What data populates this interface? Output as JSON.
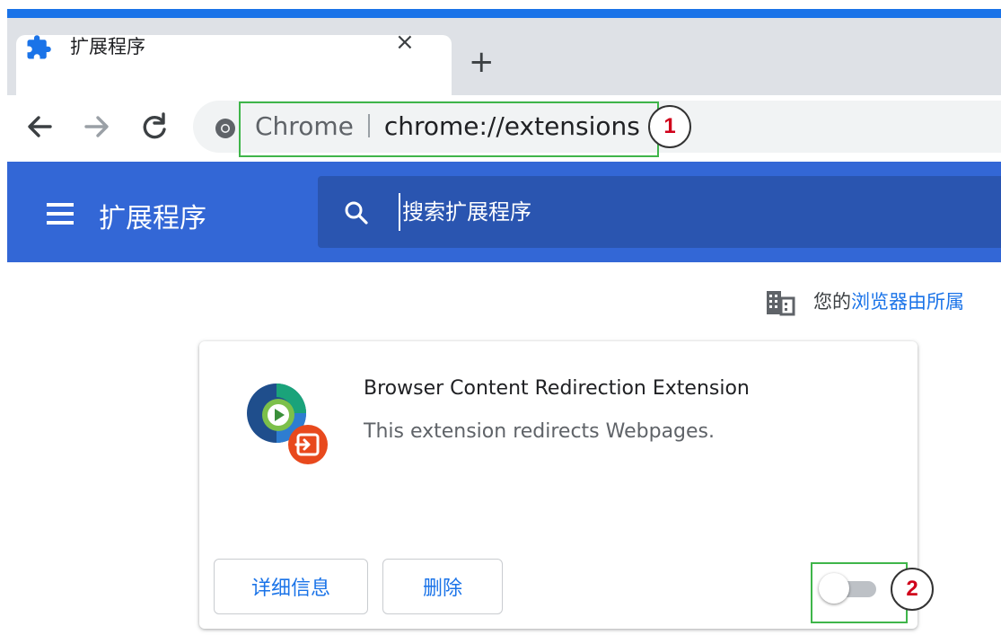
{
  "tab": {
    "title": "扩展程序",
    "close_glyph": "×",
    "new_tab_glyph": "+",
    "icon": "puzzle-icon"
  },
  "toolbar": {
    "back_icon": "arrow-left-icon",
    "forward_icon": "arrow-right-icon",
    "reload_icon": "reload-icon",
    "omnibox": {
      "site_label": "Chrome",
      "url": "chrome://extensions",
      "site_icon": "chrome-icon"
    }
  },
  "header": {
    "title": "扩展程序",
    "search_placeholder": "搜索扩展程序",
    "brand_color": "#3367d6"
  },
  "managed_notice": {
    "prefix": "您的",
    "link_text": "浏览器由所属"
  },
  "extension": {
    "name": "Browser Content Redirection Extension",
    "description": "This extension redirects Webpages.",
    "details_label": "详细信息",
    "remove_label": "删除",
    "enabled": false
  },
  "annotations": {
    "callout_1": "1",
    "callout_2": "2",
    "highlight_color": "#3fb54a"
  }
}
